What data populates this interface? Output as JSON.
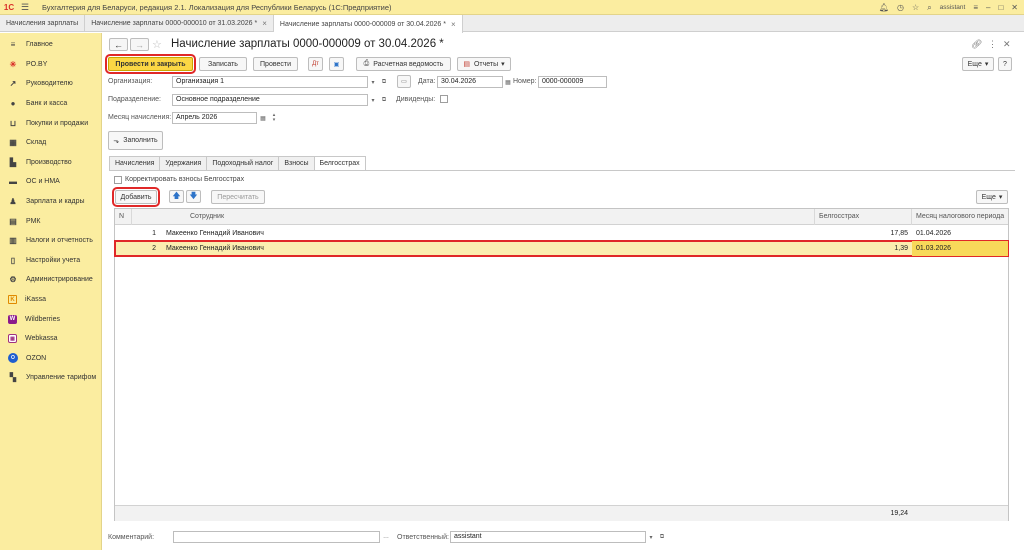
{
  "app": {
    "logo": "1С",
    "title": "Бухгалтерия для Беларуси, редакция 2.1. Локализация для Республики Беларусь  (1С:Предприятие)",
    "user": "assistant"
  },
  "window_tabs": [
    {
      "label": "Начисления зарплаты",
      "closable": false
    },
    {
      "label": "Начисление зарплаты 0000-000010 от 31.03.2026 *",
      "closable": true
    },
    {
      "label": "Начисление зарплаты 0000-000009 от 30.04.2026 *",
      "closable": true,
      "active": true
    }
  ],
  "sidebar": {
    "items": [
      {
        "label": "Главное",
        "icon": "menu-icon"
      },
      {
        "label": "PO.BY",
        "icon": "asterisk-icon"
      },
      {
        "label": "Руководителю",
        "icon": "trend-icon"
      },
      {
        "label": "Банк и касса",
        "icon": "coin-icon"
      },
      {
        "label": "Покупки и продажи",
        "icon": "cart-icon"
      },
      {
        "label": "Склад",
        "icon": "warehouse-icon"
      },
      {
        "label": "Производство",
        "icon": "factory-icon"
      },
      {
        "label": "ОС и НМА",
        "icon": "truck-icon"
      },
      {
        "label": "Зарплата и кадры",
        "icon": "person-icon"
      },
      {
        "label": "РМК",
        "icon": "register-icon"
      },
      {
        "label": "Налоги и отчетность",
        "icon": "chart-icon"
      },
      {
        "label": "Настройки учета",
        "icon": "doc-icon"
      },
      {
        "label": "Администрирование",
        "icon": "gear-icon"
      },
      {
        "label": "iKassa",
        "icon": "ikassa-icon"
      },
      {
        "label": "Wildberries",
        "icon": "wildberries-icon"
      },
      {
        "label": "Webkassa",
        "icon": "webkassa-icon"
      },
      {
        "label": "OZON",
        "icon": "ozon-icon"
      },
      {
        "label": "Управление тарифом",
        "icon": "grid-icon"
      }
    ]
  },
  "document": {
    "title": "Начисление зарплаты 0000-000009 от 30.04.2026 *",
    "toolbar": {
      "post_close": "Провести и закрыть",
      "save": "Записать",
      "post": "Провести",
      "payroll": "Расчетная ведомость",
      "reports": "Отчеты",
      "more": "Еще"
    },
    "fields": {
      "org_label": "Организация:",
      "org_value": "Организация 1",
      "date_label": "Дата:",
      "date_value": "30.04.2026",
      "number_label": "Номер:",
      "number_value": "0000-000009",
      "dept_label": "Подразделение:",
      "dept_value": "Основное подразделение",
      "dividends_label": "Дивиденды:",
      "month_label": "Месяц начисления:",
      "month_value": "Апрель 2026"
    },
    "fill_button": "Заполнить",
    "tabs": [
      "Начисления",
      "Удержания",
      "Подоходный налог",
      "Взносы",
      "Белгосстрах"
    ],
    "active_tab": "Белгосстрах",
    "correct_checkbox": "Корректировать взносы Белгосстрах",
    "table_toolbar": {
      "add": "Добавить",
      "recalc": "Пересчитать",
      "more": "Еще"
    },
    "table": {
      "columns": [
        "N",
        "Сотрудник",
        "Белгосстрах",
        "Месяц налогового периода"
      ],
      "rows": [
        {
          "n": "1",
          "employee": "Макеенко Геннадий Иванович",
          "amount": "17,85",
          "month": "01.04.2026"
        },
        {
          "n": "2",
          "employee": "Макеенко Геннадий Иванович",
          "amount": "1,39",
          "month": "01.03.2026"
        }
      ],
      "total": "19,24"
    },
    "footer": {
      "comment_label": "Комментарий:",
      "comment_value": "",
      "responsible_label": "Ответственный:",
      "responsible_value": "assistant"
    }
  }
}
